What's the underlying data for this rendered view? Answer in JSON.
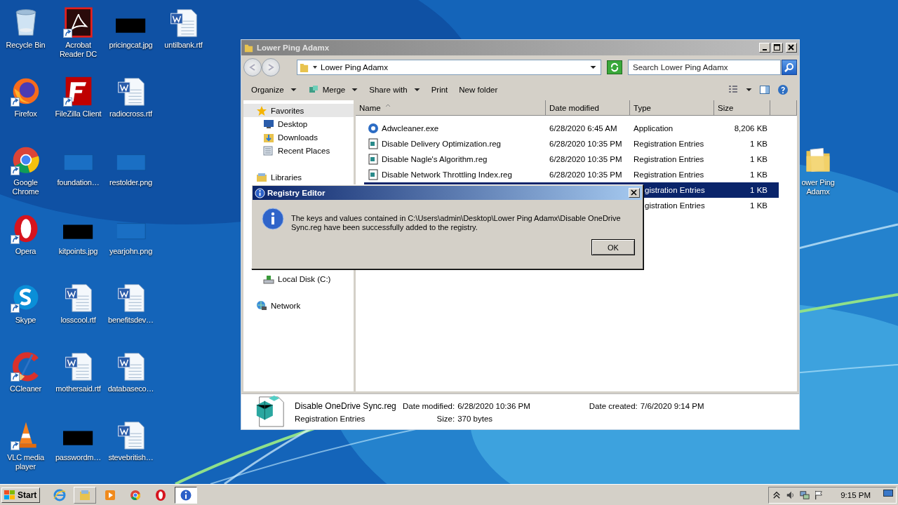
{
  "desktop_icons": [
    {
      "kind": "recycle",
      "label": "Recycle Bin",
      "shortcut": false
    },
    {
      "kind": "firefox",
      "label": "Firefox",
      "shortcut": true
    },
    {
      "kind": "chrome",
      "label": "Google Chrome",
      "shortcut": true
    },
    {
      "kind": "opera",
      "label": "Opera",
      "shortcut": true
    },
    {
      "kind": "skype",
      "label": "Skype",
      "shortcut": true
    },
    {
      "kind": "ccleaner",
      "label": "CCleaner",
      "shortcut": true
    },
    {
      "kind": "vlc",
      "label": "VLC media player",
      "shortcut": true
    },
    {
      "kind": "acrobat",
      "label": "Acrobat Reader DC",
      "shortcut": true
    },
    {
      "kind": "filezilla",
      "label": "FileZilla Client",
      "shortcut": true
    },
    {
      "kind": "blank-image",
      "label": "foundation…",
      "shortcut": false
    },
    {
      "kind": "dark-image",
      "label": "kitpoints.jpg",
      "shortcut": false
    },
    {
      "kind": "word",
      "label": "losscool.rtf",
      "shortcut": false
    },
    {
      "kind": "word",
      "label": "mothersaid.rtf",
      "shortcut": false
    },
    {
      "kind": "dark-image",
      "label": "passwordm…",
      "shortcut": false
    },
    {
      "kind": "dark-image",
      "label": "pricingcat.jpg",
      "shortcut": false
    },
    {
      "kind": "word",
      "label": "radiocross.rtf",
      "shortcut": false
    },
    {
      "kind": "blank-image",
      "label": "restolder.png",
      "shortcut": false
    },
    {
      "kind": "blank-image",
      "label": "yearjohn.png",
      "shortcut": false
    },
    {
      "kind": "word",
      "label": "benefitsdev…",
      "shortcut": false
    },
    {
      "kind": "word",
      "label": "databaseco…",
      "shortcut": false
    },
    {
      "kind": "word",
      "label": "stevebritish…",
      "shortcut": false
    },
    {
      "kind": "word",
      "label": "untilbank.rtf",
      "shortcut": false
    }
  ],
  "desktop_folder": {
    "label": "ower Ping Adamx"
  },
  "explorer": {
    "title": "Lower Ping Adamx",
    "address": "Lower Ping Adamx",
    "search_placeholder": "Search Lower Ping Adamx",
    "toolbar": [
      {
        "label": "Organize",
        "dropdown": true,
        "icon": false
      },
      {
        "label": "Merge",
        "dropdown": true,
        "icon": true
      },
      {
        "label": "Share with",
        "dropdown": true,
        "icon": false
      },
      {
        "label": "Print",
        "dropdown": false,
        "icon": false
      },
      {
        "label": "New folder",
        "dropdown": false,
        "icon": false
      }
    ],
    "nav": [
      {
        "label": "Favorites",
        "kind": "star",
        "selected": true,
        "children": [
          {
            "label": "Desktop",
            "kind": "desktop",
            "selected": false
          },
          {
            "label": "Downloads",
            "kind": "downloads",
            "selected": false
          },
          {
            "label": "Recent Places",
            "kind": "recent",
            "selected": false
          }
        ]
      },
      {
        "label": "Libraries",
        "kind": "library",
        "selected": false
      },
      {
        "children": [
          {
            "label": "Local Disk (C:)",
            "kind": "disk",
            "selected": false
          }
        ]
      },
      {
        "label": "Network",
        "kind": "network",
        "selected": false
      }
    ],
    "columns": [
      "Name",
      "Date modified",
      "Type",
      "Size"
    ],
    "files": [
      {
        "kind": "application",
        "name": "Adwcleaner.exe",
        "date": "6/28/2020 6:45 AM",
        "type": "Application",
        "size": "8,206 KB",
        "selected": false
      },
      {
        "kind": "registration",
        "name": "Disable Delivery Optimization.reg",
        "date": "6/28/2020 10:35 PM",
        "type": "Registration Entries",
        "size": "1 KB",
        "selected": false
      },
      {
        "kind": "registration",
        "name": "Disable Nagle's Algorithm.reg",
        "date": "6/28/2020 10:35 PM",
        "type": "Registration Entries",
        "size": "1 KB",
        "selected": false
      },
      {
        "kind": "registration",
        "name": "Disable Network Throttling Index.reg",
        "date": "6/28/2020 10:35 PM",
        "type": "Registration Entries",
        "size": "1 KB",
        "selected": false
      },
      {
        "type": "gistration Entries",
        "size": "1 KB",
        "selected": true
      },
      {
        "type": "gistration Entries",
        "size": "1 KB",
        "selected": false
      }
    ],
    "details": {
      "name": "Disable OneDrive Sync.reg",
      "type": "Registration Entries",
      "fields": [
        {
          "label": "Date modified:",
          "value": "6/28/2020 10:36 PM"
        },
        {
          "label": "Size:",
          "value": "370 bytes"
        },
        {
          "label": "Date created:",
          "value": "7/6/2020 9:14 PM"
        }
      ]
    }
  },
  "dialog": {
    "title": "Registry Editor",
    "message": "The keys and values contained in C:\\Users\\admin\\Desktop\\Lower Ping Adamx\\Disable OneDrive Sync.reg have been successfully added to the registry.",
    "button": "OK"
  },
  "taskbar": {
    "start": "Start",
    "apps": [
      {
        "kind": "ie",
        "running": false,
        "active": false
      },
      {
        "kind": "explorer",
        "running": true,
        "active": false
      },
      {
        "kind": "media",
        "running": false,
        "active": false
      },
      {
        "kind": "chrome",
        "running": false,
        "active": false
      },
      {
        "kind": "opera",
        "running": false,
        "active": false
      },
      {
        "kind": "info",
        "running": true,
        "active": true
      }
    ],
    "clock": "9:15 PM"
  }
}
